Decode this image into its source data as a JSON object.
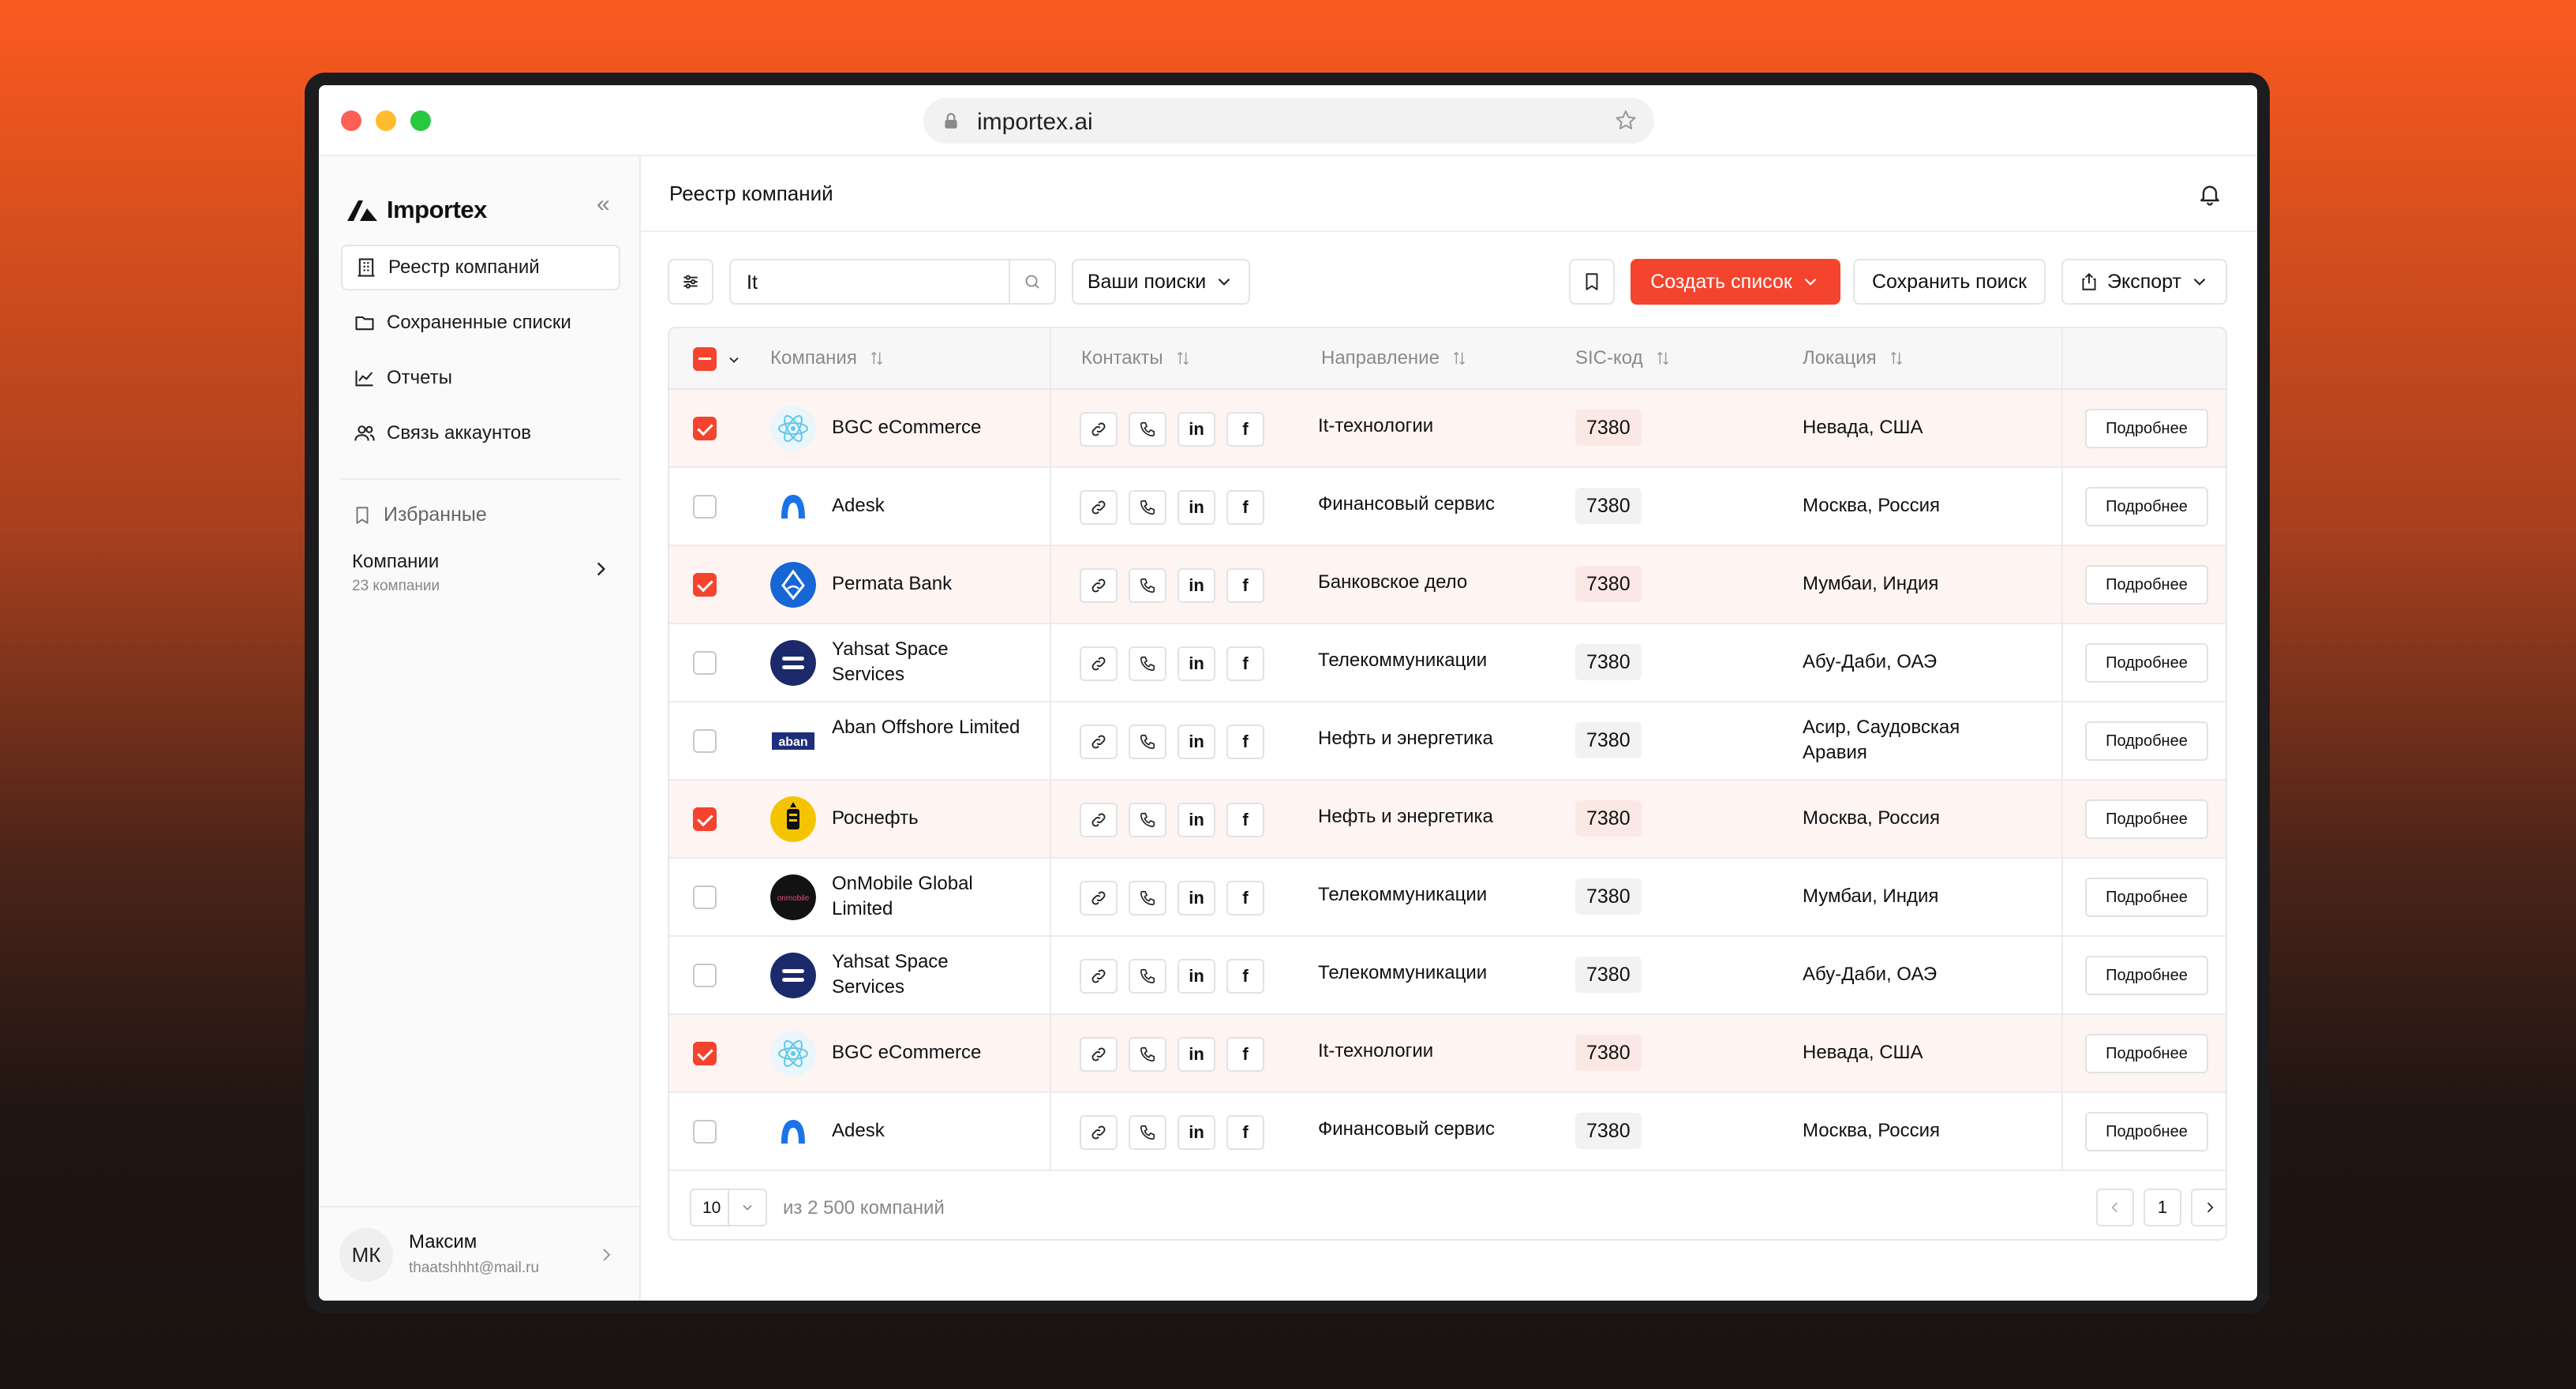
{
  "browser": {
    "url": "importex.ai"
  },
  "sidebar": {
    "logo": "Importex",
    "collapse": "«",
    "items": [
      {
        "label": "Реестр компаний",
        "icon": "building-icon",
        "active": true
      },
      {
        "label": "Сохраненные списки",
        "icon": "folder-icon",
        "active": false
      },
      {
        "label": "Отчеты",
        "icon": "chart-icon",
        "active": false
      },
      {
        "label": "Связь аккаунтов",
        "icon": "users-icon",
        "active": false
      }
    ],
    "favorites": {
      "label": "Избранные",
      "group_title": "Компании",
      "group_count": "23 компании"
    },
    "user": {
      "initials": "МК",
      "name": "Максим",
      "email": "thaatshhht@mail.ru"
    }
  },
  "header": {
    "title": "Реестр компаний"
  },
  "toolbar": {
    "search_value": "It",
    "saved_searches": "Ваши поиски",
    "create_list": "Создать список",
    "save_search": "Сохранить поиск",
    "export": "Экспорт"
  },
  "table": {
    "columns": [
      "Компания",
      "Контакты",
      "Направление",
      "SIC-код",
      "Локация"
    ],
    "more_label": "Подробнее",
    "rows": [
      {
        "selected": true,
        "logo": "react-logo",
        "company": "BGC eCommerce",
        "direction": "It-технологии",
        "sic": "7380",
        "location": "Невада, США"
      },
      {
        "selected": false,
        "logo": "adesk-logo",
        "company": "Adesk",
        "direction": "Финансовый сервис",
        "sic": "7380",
        "location": "Москва, Россия"
      },
      {
        "selected": true,
        "logo": "permata-logo",
        "company": "Permata Bank",
        "direction": "Банковское дело",
        "sic": "7380",
        "location": "Мумбаи, Индия"
      },
      {
        "selected": false,
        "logo": "yahsat-logo",
        "company": "Yahsat Space Services",
        "direction": "Телекоммуникации",
        "sic": "7380",
        "location": "Абу-Даби, ОАЭ"
      },
      {
        "selected": false,
        "logo": "aban-logo",
        "company": "Aban Offshore Limited",
        "direction": "Нефть и энергетика",
        "sic": "7380",
        "location": "Асир, Саудовская Аравия"
      },
      {
        "selected": true,
        "logo": "rosneft-logo",
        "company": "Роснефть",
        "direction": "Нефть и энергетика",
        "sic": "7380",
        "location": "Москва, Россия"
      },
      {
        "selected": false,
        "logo": "onmobile-logo",
        "company": "OnMobile Global Limited",
        "direction": "Телекоммуникации",
        "sic": "7380",
        "location": "Мумбаи, Индия"
      },
      {
        "selected": false,
        "logo": "yahsat-logo",
        "company": "Yahsat Space Services",
        "direction": "Телекоммуникации",
        "sic": "7380",
        "location": "Абу-Даби, ОАЭ"
      },
      {
        "selected": true,
        "logo": "react-logo",
        "company": "BGC eCommerce",
        "direction": "It-технологии",
        "sic": "7380",
        "location": "Невада, США"
      },
      {
        "selected": false,
        "logo": "adesk-logo",
        "company": "Adesk",
        "direction": "Финансовый сервис",
        "sic": "7380",
        "location": "Москва, Россия"
      }
    ],
    "footer": {
      "per_page": "10",
      "total": "из 2 500 компаний",
      "page": "1"
    }
  },
  "colors": {
    "accent": "#f4442e",
    "selected_row": "#fef4f2"
  }
}
